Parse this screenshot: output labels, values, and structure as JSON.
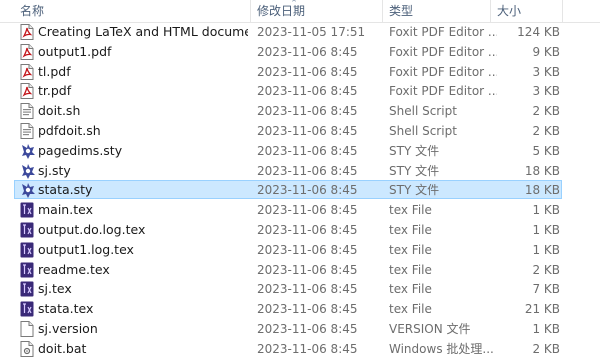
{
  "columns": {
    "name": "名称",
    "modified": "修改日期",
    "type": "类型",
    "size": "大小"
  },
  "files": [
    {
      "name": "Creating LaTeX and HTML document...",
      "modified": "2023-11-05 17:51",
      "type": "Foxit PDF Editor ...",
      "size": "124 KB",
      "icon": "pdf-file-icon"
    },
    {
      "name": "output1.pdf",
      "modified": "2023-11-06 8:45",
      "type": "Foxit PDF Editor ...",
      "size": "9 KB",
      "icon": "pdf-file-icon"
    },
    {
      "name": "tl.pdf",
      "modified": "2023-11-06 8:45",
      "type": "Foxit PDF Editor ...",
      "size": "3 KB",
      "icon": "pdf-file-icon"
    },
    {
      "name": "tr.pdf",
      "modified": "2023-11-06 8:45",
      "type": "Foxit PDF Editor ...",
      "size": "3 KB",
      "icon": "pdf-file-icon"
    },
    {
      "name": "doit.sh",
      "modified": "2023-11-06 8:45",
      "type": "Shell Script",
      "size": "2 KB",
      "icon": "shell-script-icon"
    },
    {
      "name": "pdfdoit.sh",
      "modified": "2023-11-06 8:45",
      "type": "Shell Script",
      "size": "2 KB",
      "icon": "shell-script-icon"
    },
    {
      "name": "pagedims.sty",
      "modified": "2023-11-06 8:45",
      "type": "STY 文件",
      "size": "5 KB",
      "icon": "sty-file-icon"
    },
    {
      "name": "sj.sty",
      "modified": "2023-11-06 8:45",
      "type": "STY 文件",
      "size": "18 KB",
      "icon": "sty-file-icon"
    },
    {
      "name": "stata.sty",
      "modified": "2023-11-06 8:45",
      "type": "STY 文件",
      "size": "18 KB",
      "icon": "sty-file-icon",
      "selected": true
    },
    {
      "name": "main.tex",
      "modified": "2023-11-06 8:45",
      "type": "tex File",
      "size": "1 KB",
      "icon": "tex-file-icon"
    },
    {
      "name": "output.do.log.tex",
      "modified": "2023-11-06 8:45",
      "type": "tex File",
      "size": "1 KB",
      "icon": "tex-file-icon"
    },
    {
      "name": "output1.log.tex",
      "modified": "2023-11-06 8:45",
      "type": "tex File",
      "size": "1 KB",
      "icon": "tex-file-icon"
    },
    {
      "name": "readme.tex",
      "modified": "2023-11-06 8:45",
      "type": "tex File",
      "size": "2 KB",
      "icon": "tex-file-icon"
    },
    {
      "name": "sj.tex",
      "modified": "2023-11-06 8:45",
      "type": "tex File",
      "size": "7 KB",
      "icon": "tex-file-icon"
    },
    {
      "name": "stata.tex",
      "modified": "2023-11-06 8:45",
      "type": "tex File",
      "size": "21 KB",
      "icon": "tex-file-icon"
    },
    {
      "name": "sj.version",
      "modified": "2023-11-06 8:45",
      "type": "VERSION 文件",
      "size": "1 KB",
      "icon": "generic-file-icon"
    },
    {
      "name": "doit.bat",
      "modified": "2023-11-06 8:45",
      "type": "Windows 批处理...",
      "size": "2 KB",
      "icon": "batch-file-icon"
    }
  ],
  "colors": {
    "selection_bg": "#cce8ff",
    "selection_border": "#99d1ff",
    "header_text": "#4c607a",
    "pdf_red": "#c4161c",
    "tex_purple": "#4b2d7f"
  }
}
